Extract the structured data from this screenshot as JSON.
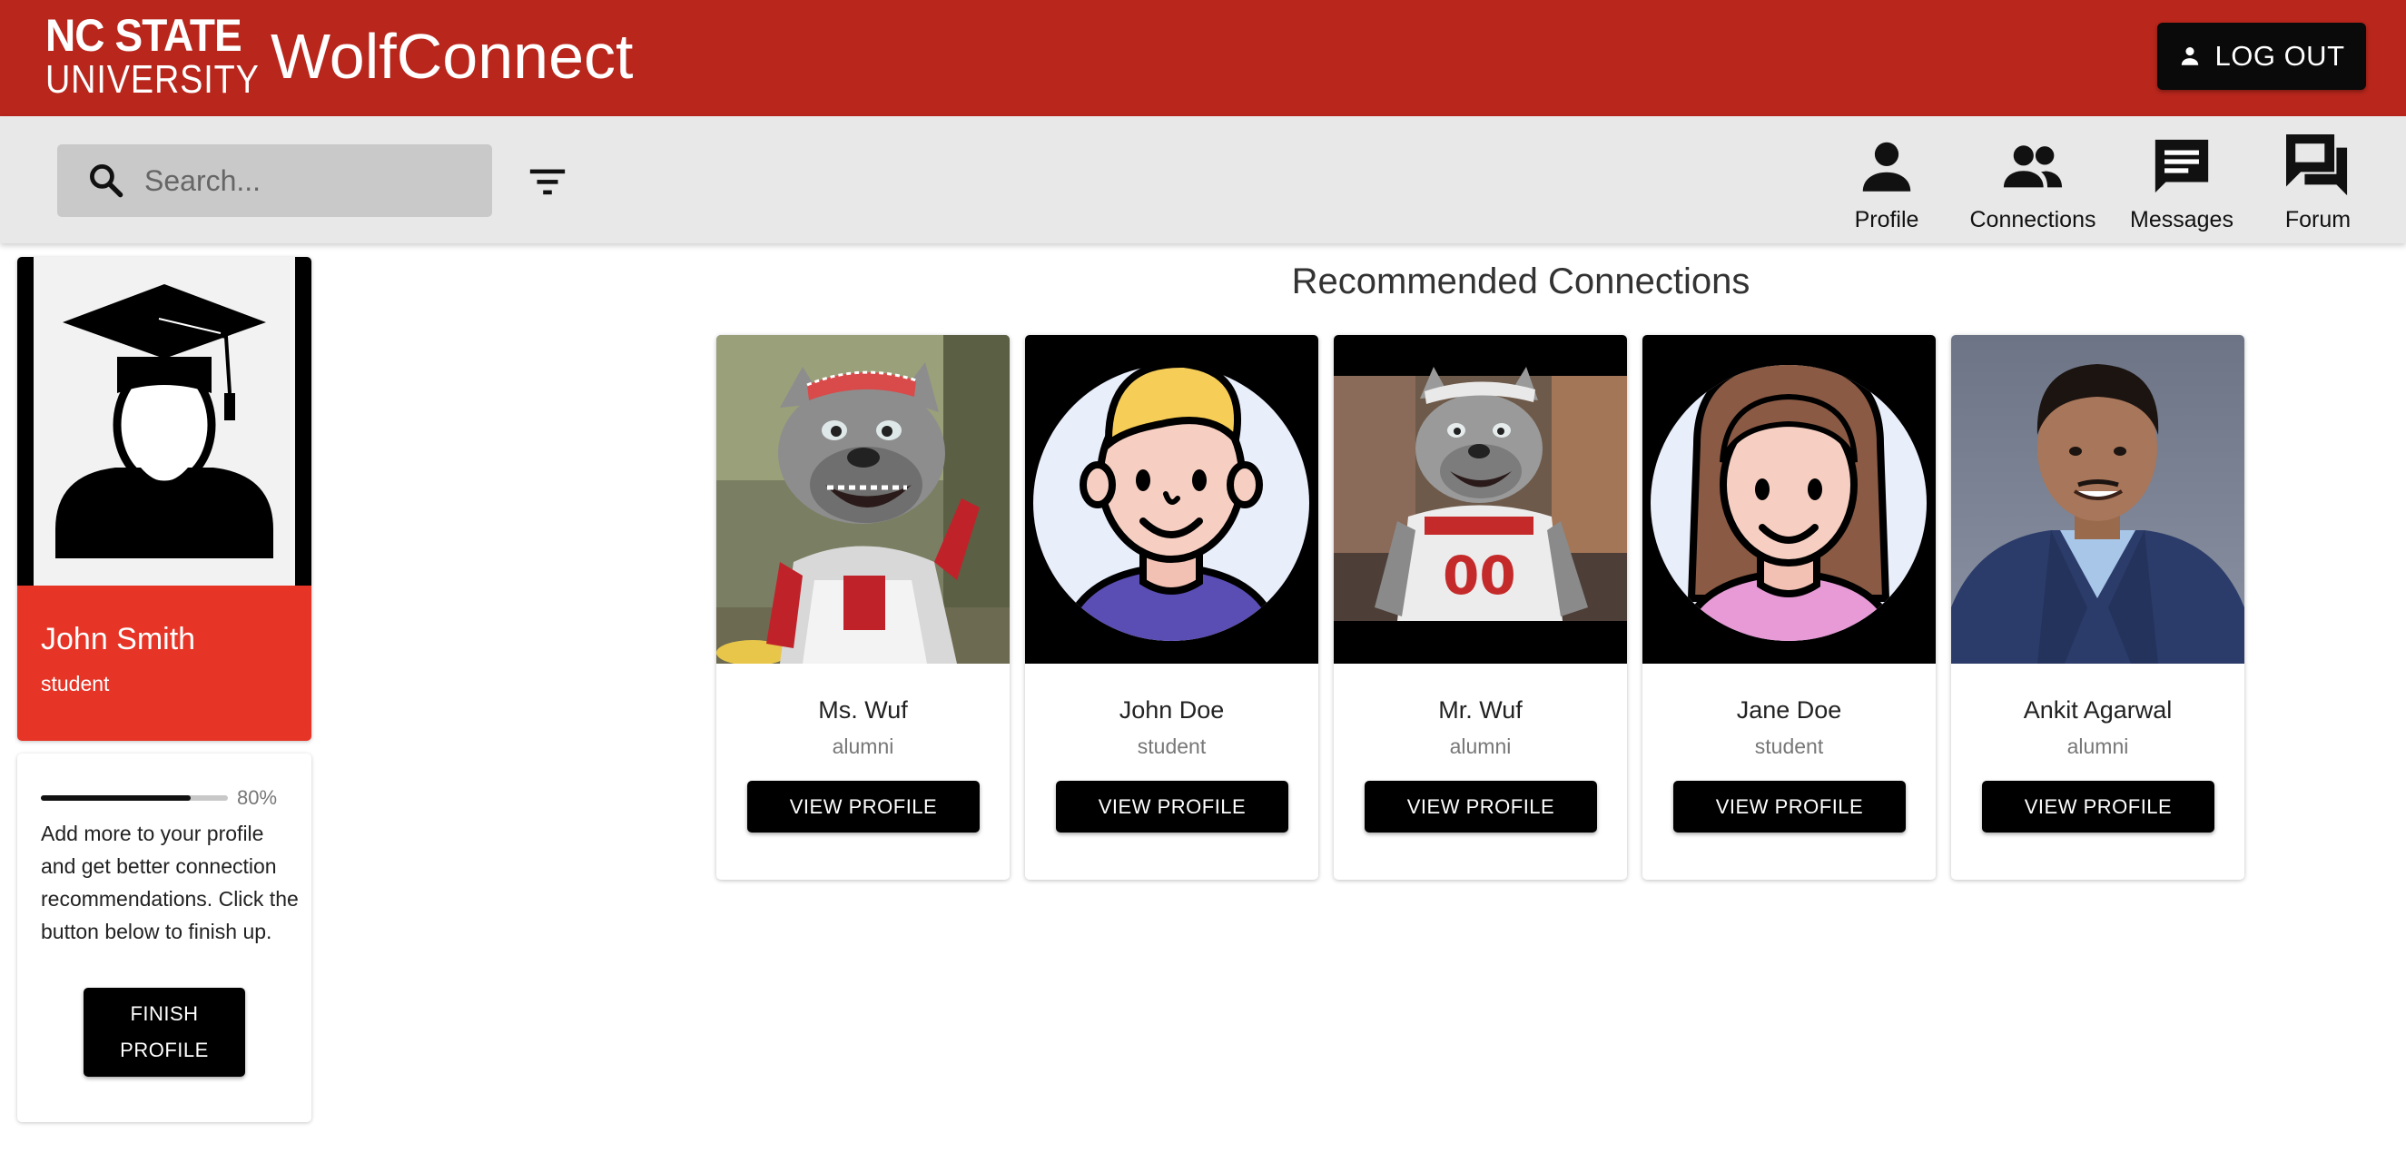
{
  "header": {
    "logo_line1": "NC STATE",
    "logo_line2": "UNIVERSITY",
    "app_title": "WolfConnect",
    "logout_label": "LOG OUT",
    "brand_color": "#b8261c"
  },
  "toolbar": {
    "search_placeholder": "Search...",
    "filter_icon": "filter-icon",
    "nav": [
      {
        "label": "Profile",
        "icon": "person-icon"
      },
      {
        "label": "Connections",
        "icon": "people-icon"
      },
      {
        "label": "Messages",
        "icon": "message-icon"
      },
      {
        "label": "Forum",
        "icon": "forum-icon"
      }
    ]
  },
  "profile": {
    "name": "John Smith",
    "role": "student",
    "accent_color": "#e63426"
  },
  "completion": {
    "progress_percent": 80,
    "progress_label": "80%",
    "message": "Add more to your profile and get better connection recommendations. Click the button below to finish up.",
    "button_line1": "FINISH",
    "button_line2": "PROFILE"
  },
  "recommended": {
    "title": "Recommended Connections",
    "view_label": "VIEW PROFILE",
    "people": [
      {
        "name": "Ms. Wuf",
        "role": "alumni"
      },
      {
        "name": "John Doe",
        "role": "student"
      },
      {
        "name": "Mr. Wuf",
        "role": "alumni"
      },
      {
        "name": "Jane Doe",
        "role": "student"
      },
      {
        "name": "Ankit Agarwal",
        "role": "alumni"
      }
    ]
  }
}
